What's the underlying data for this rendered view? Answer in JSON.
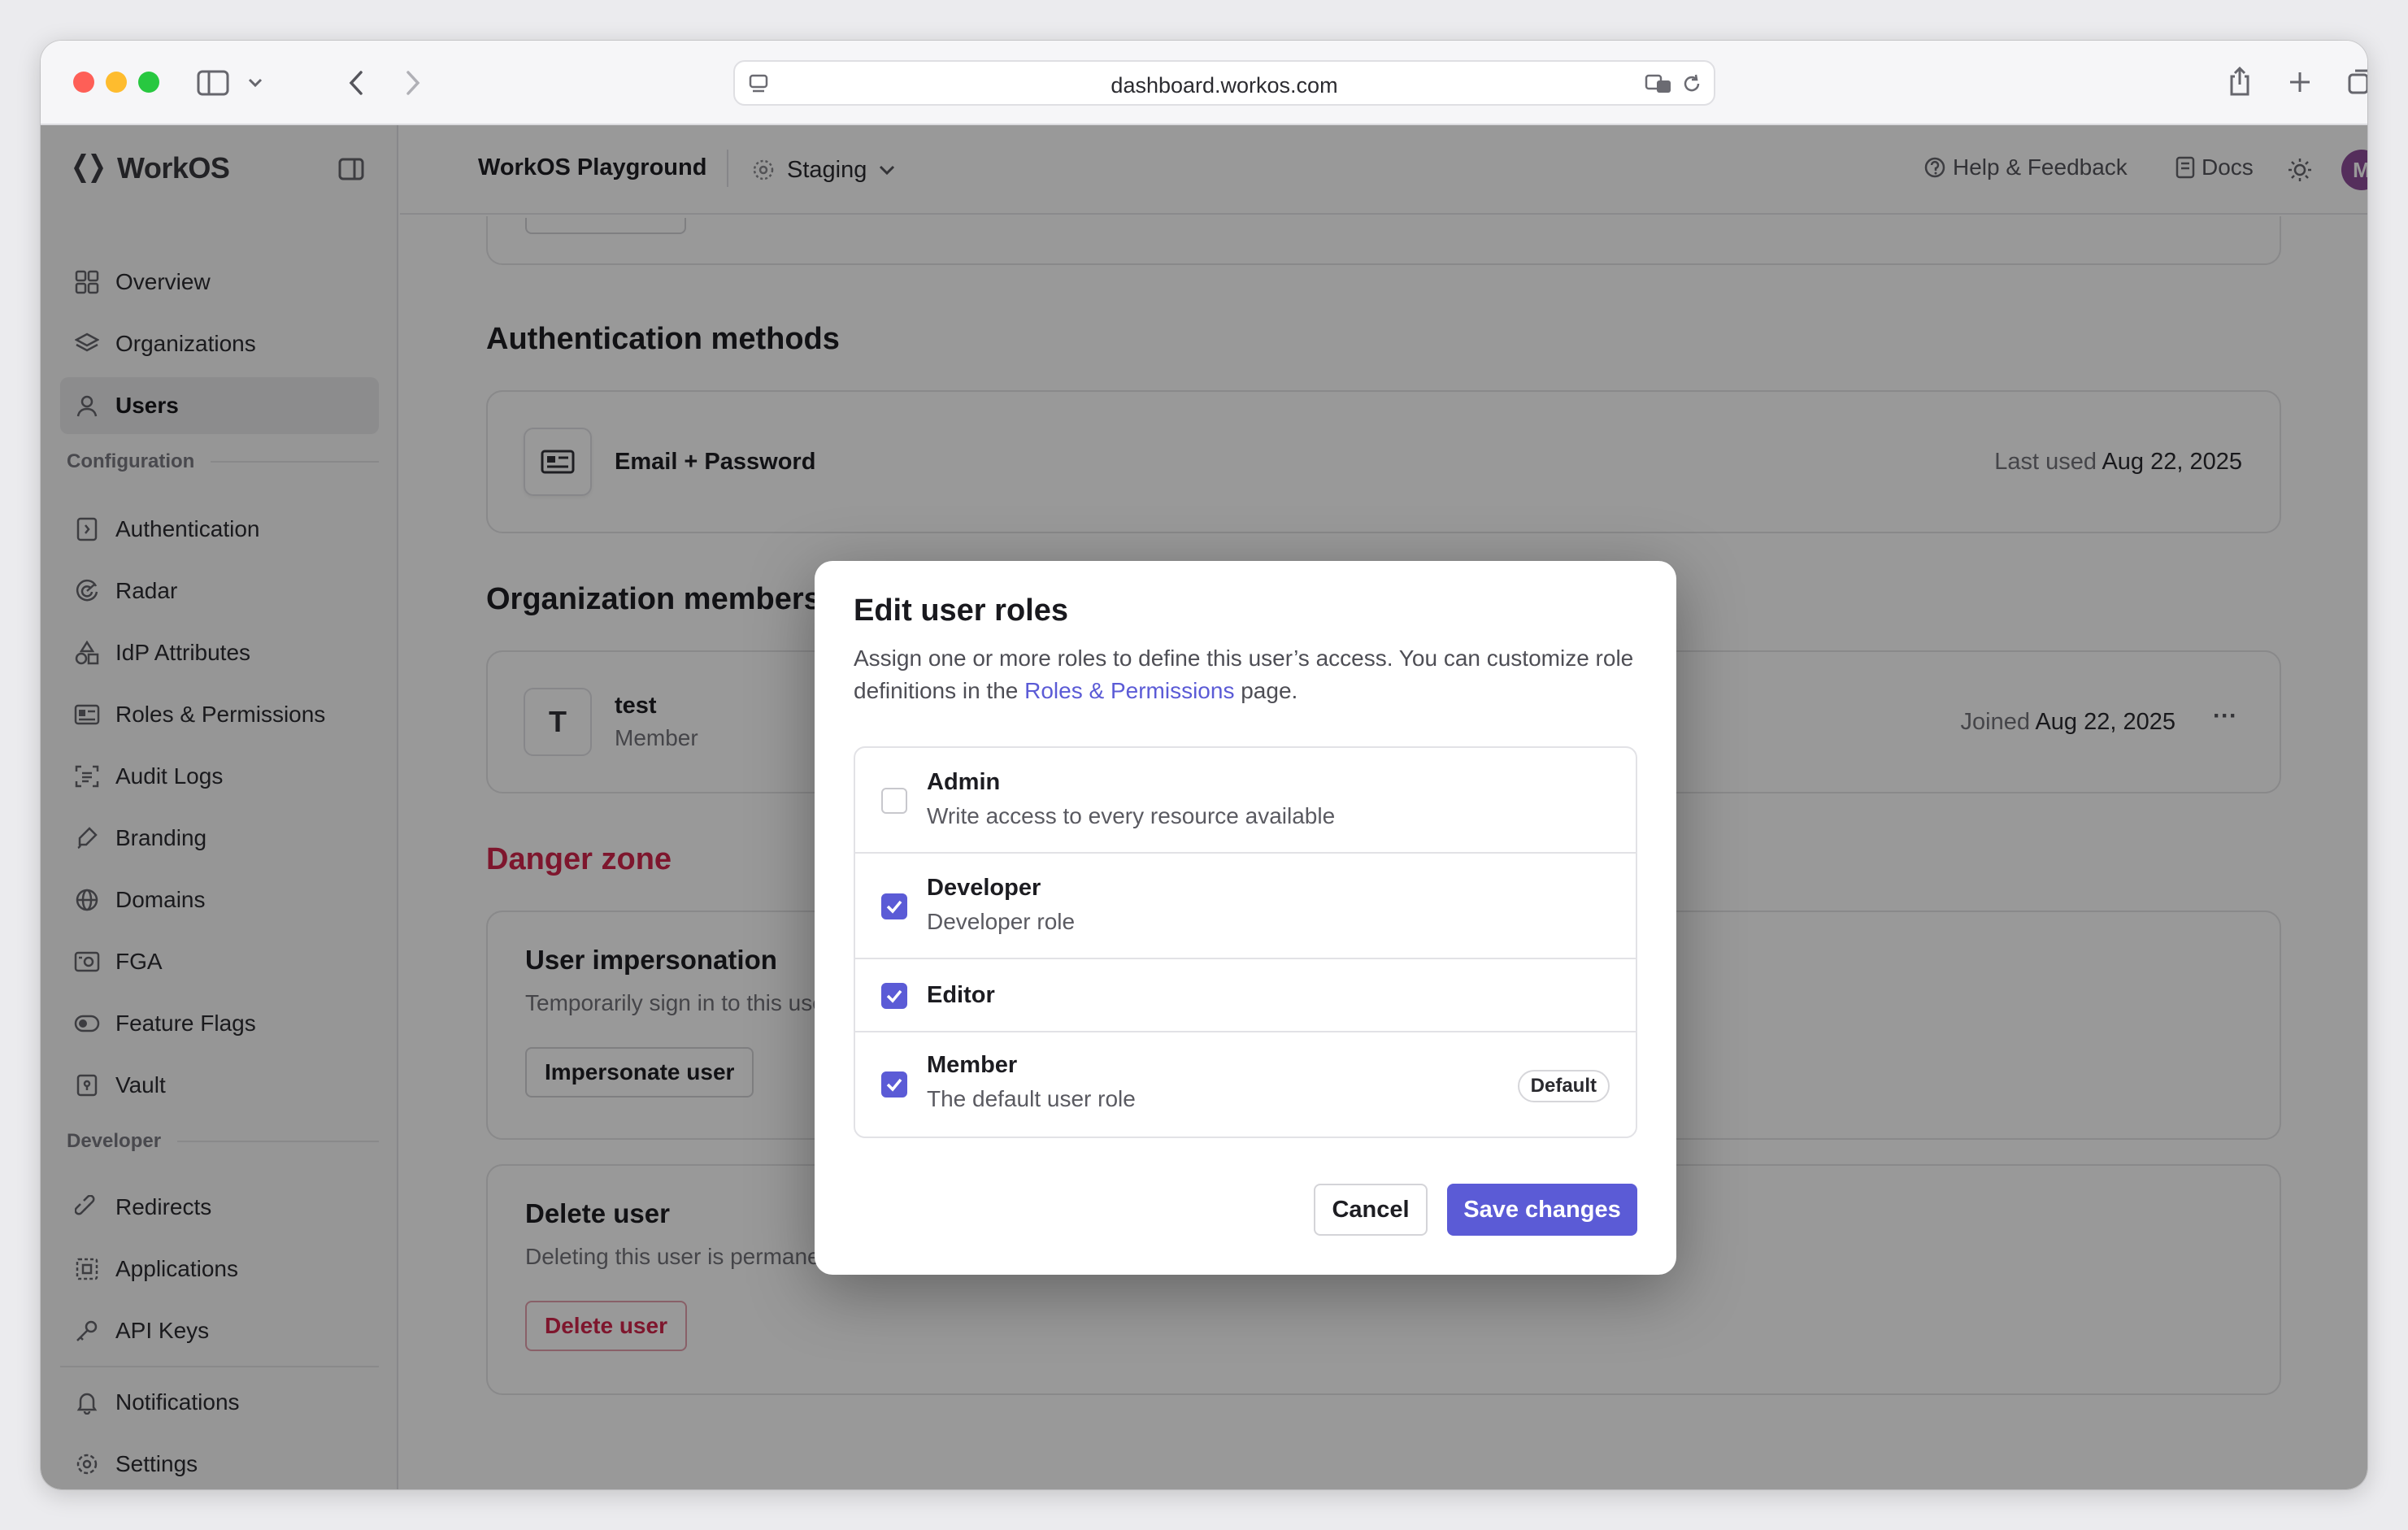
{
  "browser": {
    "url": "dashboard.workos.com"
  },
  "sidebar": {
    "brand": "WorkOS",
    "items_top": [
      {
        "label": "Overview",
        "icon": "grid-icon"
      },
      {
        "label": "Organizations",
        "icon": "layers-icon"
      },
      {
        "label": "Users",
        "icon": "user-icon",
        "active": true
      }
    ],
    "configuration_label": "Configuration",
    "items_config": [
      {
        "label": "Authentication",
        "icon": "auth-icon"
      },
      {
        "label": "Radar",
        "icon": "radar-icon"
      },
      {
        "label": "IdP Attributes",
        "icon": "shapes-icon"
      },
      {
        "label": "Roles & Permissions",
        "icon": "id-card-icon"
      },
      {
        "label": "Audit Logs",
        "icon": "scan-icon"
      },
      {
        "label": "Branding",
        "icon": "brush-icon"
      },
      {
        "label": "Domains",
        "icon": "globe-icon"
      },
      {
        "label": "FGA",
        "icon": "fga-icon"
      },
      {
        "label": "Feature Flags",
        "icon": "toggle-icon"
      },
      {
        "label": "Vault",
        "icon": "vault-icon"
      }
    ],
    "developer_label": "Developer",
    "items_dev": [
      {
        "label": "Redirects",
        "icon": "link-icon"
      },
      {
        "label": "Applications",
        "icon": "app-icon"
      },
      {
        "label": "API Keys",
        "icon": "key-icon"
      }
    ],
    "items_bottom": [
      {
        "label": "Notifications",
        "icon": "bell-icon"
      },
      {
        "label": "Settings",
        "icon": "gear-icon"
      }
    ]
  },
  "header": {
    "workspace": "WorkOS Playground",
    "environment": "Staging",
    "help": "Help & Feedback",
    "docs": "Docs",
    "avatar_initial": "M"
  },
  "main": {
    "auth_methods": {
      "title": "Authentication methods",
      "method": "Email + Password",
      "last_used_label": "Last used",
      "last_used_date": "Aug 22, 2025"
    },
    "org_memberships": {
      "title": "Organization memberships",
      "avatar": "T",
      "org_name": "test",
      "role": "Member",
      "joined_label": "Joined",
      "joined_date": "Aug 22, 2025",
      "more": "···"
    },
    "danger_zone": {
      "title": "Danger zone",
      "impersonation_title": "User impersonation",
      "impersonation_desc": "Temporarily sign in to this user's account",
      "impersonate_button": "Impersonate user",
      "delete_title": "Delete user",
      "delete_desc": "Deleting this user is permanent and cannot be undone.",
      "delete_button": "Delete user"
    }
  },
  "modal": {
    "title": "Edit user roles",
    "desc_before": "Assign one or more roles to define this user’s access. You can customize role definitions in the ",
    "desc_link": "Roles & Permissions",
    "desc_after": " page.",
    "roles": [
      {
        "name": "Admin",
        "description": "Write access to every resource available",
        "checked": false
      },
      {
        "name": "Developer",
        "description": "Developer role",
        "checked": true
      },
      {
        "name": "Editor",
        "description": "",
        "checked": true
      },
      {
        "name": "Member",
        "description": "The default user role",
        "checked": true,
        "badge": "Default"
      }
    ],
    "cancel": "Cancel",
    "save": "Save changes"
  },
  "colors": {
    "accent": "#5b5bd6",
    "danger": "#d2254b"
  }
}
